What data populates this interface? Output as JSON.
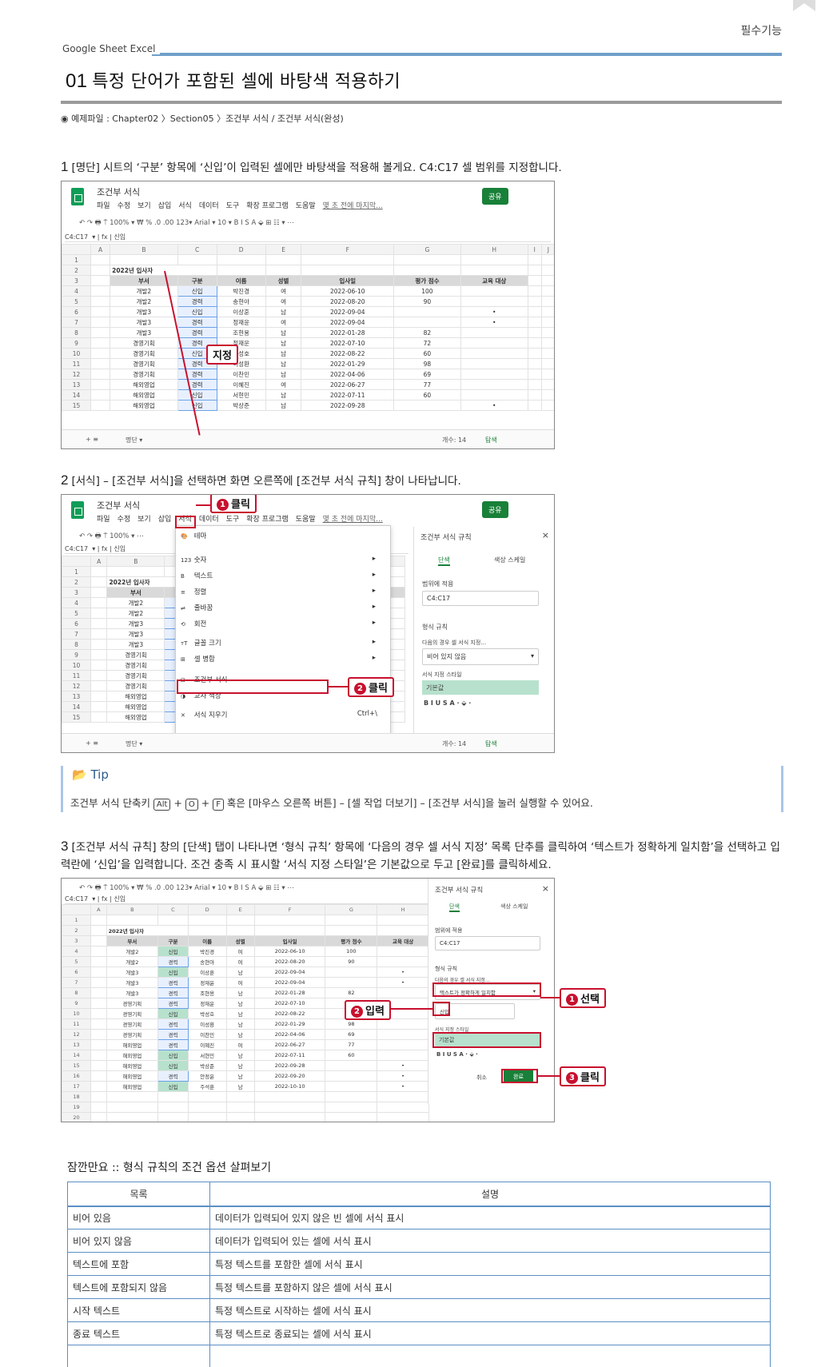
{
  "header": {
    "tag": "필수기능",
    "brand": "Google Sheet  Excel"
  },
  "title": {
    "number": "01",
    "text": "특정 단어가 포함된 셀에 바탕색 적용하기"
  },
  "example_file": "◉ 예제파일 : Chapter02 〉Section05 〉조건부 서식 / 조건부 서식(완성)",
  "steps": [
    {
      "number": "1",
      "text": "[명단] 시트의 ‘구분’ 항목에 ‘신입’이 입력된 셀에만 바탕색을 적용해 볼게요. C4:C17 셀 범위를 지정합니다."
    },
    {
      "number": "2",
      "text": "[서식] – [조건부 서식]을 선택하면 화면 오른쪽에 [조건부 서식 규칙] 창이 나타납니다."
    },
    {
      "number": "3",
      "text": "[조건부 서식 규칙] 창의 [단색] 탭이 나타나면 ‘형식 규칙’ 항목에 ‘다음의 경우 셀 서식 지정’ 목록 단추를 클릭하여 ‘텍스트가 정확하게 일치함’을 선택하고 입력란에 ‘신입’을 입력합니다. 조건 충족 시 표시할 ‘서식 지정 스타일’은 기본값으로 두고 [완료]를 클릭하세요."
    }
  ],
  "sheets": {
    "doc_name": "조건부 서식",
    "menu": [
      "파일",
      "수정",
      "보기",
      "삽입",
      "서식",
      "데이터",
      "도구",
      "확장 프로그램",
      "도움말"
    ],
    "last_edit": "몇 초 전에 마지막...",
    "share": "공유",
    "toolbar": "↶  ↷  🖶  ⍑    100% ▾    ₩   %  .0  .00  123▾    Arial       ▾   10   ▾   B  I  S  A    ⬙  ⊞  ☷ ▾   ⋯",
    "toolbar_short": "↶  ↷  🖶  ⍑    100% ▾    ⋯",
    "name_box": "C4:C17",
    "fx_value": "신입",
    "col_headers": [
      "A",
      "B",
      "C",
      "D",
      "E",
      "F",
      "G",
      "H",
      "I",
      "J"
    ],
    "sheet_title": "2022년 입사자",
    "table_headers": [
      "부서",
      "구분",
      "이름",
      "성별",
      "입사일",
      "평가 점수",
      "교육 대상"
    ],
    "rows": [
      [
        "개발2",
        "신입",
        "박진경",
        "여",
        "2022-06-10",
        "100",
        ""
      ],
      [
        "개발2",
        "경력",
        "송현아",
        "여",
        "2022-08-20",
        "90",
        ""
      ],
      [
        "개발3",
        "신입",
        "이상훈",
        "남",
        "2022-09-04",
        "",
        "•"
      ],
      [
        "개발3",
        "경력",
        "정재윤",
        "여",
        "2022-09-04",
        "",
        "•"
      ],
      [
        "개발3",
        "경력",
        "조현용",
        "남",
        "2022-01-28",
        "82",
        ""
      ],
      [
        "경영기획",
        "경력",
        "정재운",
        "남",
        "2022-07-10",
        "72",
        ""
      ],
      [
        "경영기획",
        "신입",
        "박성호",
        "남",
        "2022-08-22",
        "60",
        ""
      ],
      [
        "경영기획",
        "경력",
        "이성환",
        "남",
        "2022-01-29",
        "98",
        ""
      ],
      [
        "경영기획",
        "경력",
        "이찬민",
        "남",
        "2022-04-06",
        "69",
        ""
      ],
      [
        "해외영업",
        "경력",
        "이혜진",
        "여",
        "2022-06-27",
        "77",
        ""
      ],
      [
        "해외영업",
        "신입",
        "서현민",
        "남",
        "2022-07-11",
        "60",
        ""
      ],
      [
        "해외영업",
        "신입",
        "박상준",
        "남",
        "2022-09-28",
        "",
        "•"
      ],
      [
        "해외영업",
        "경력",
        "안정윤",
        "남",
        "2022-09-20",
        "",
        "•"
      ],
      [
        "해외영업",
        "신입",
        "주석훈",
        "남",
        "2022-10-10",
        "",
        "•"
      ]
    ],
    "sheet_tab": "명단 ▾",
    "count": "개수: 14",
    "explore": "탐색"
  },
  "callouts": {
    "s1_select": "지정",
    "s2_click1": "클릭",
    "s2_click2": "클릭",
    "s3_select": "선택",
    "s3_input": "입력",
    "s3_click": "클릭"
  },
  "format_menu": {
    "items": [
      "테마",
      "숫자",
      "텍스트",
      "정렬",
      "줄바꿈",
      "회전",
      "글꼴 크기",
      "셀 병합",
      "조건부 서식",
      "교차 색상",
      "서식 지우기"
    ],
    "shortcut": "Ctrl+\\"
  },
  "cf_panel": {
    "title": "조건부 서식 규칙",
    "tabs": [
      "단색",
      "색상 스케일"
    ],
    "range_label": "범위에 적용",
    "range_value": "C4:C17",
    "rules_label": "형식 규칙",
    "condition_label": "다음의 경우 셀 서식 지정...",
    "condition_default": "비어 있지 않음",
    "condition_selected": "텍스트가 정확하게 일치함",
    "input_value": "신입",
    "style_label": "서식 지정 스타일",
    "style_value": "기본값",
    "cancel": "취소",
    "done": "완료"
  },
  "tip": {
    "title": "Tip",
    "text_pre": "조건부 서식 단축키 ",
    "keys": [
      "Alt",
      "O",
      "F"
    ],
    "text_post": " 혹은 [마우스 오른쪽 버튼] – [셀 작업 더보기] – [조건부 서식]을 눌러 실행할 수 있어요."
  },
  "options_table": {
    "title": "잠깐만요 :: 형식 규칙의 조건 옵션 살펴보기",
    "headers": [
      "목록",
      "설명"
    ],
    "rows": [
      [
        "비어 있음",
        "데이터가 입력되어 있지 않은 빈 셀에 서식 표시"
      ],
      [
        "비어 있지 않음",
        "데이터가 입력되어 있는 셀에 서식 표시"
      ],
      [
        "텍스트에 포함",
        "특정 텍스트를 포함한 셀에 서식 표시"
      ],
      [
        "텍스트에 포함되지 않음",
        "특정 텍스트를 포함하지 않은 셀에 서식 표시"
      ],
      [
        "시작 텍스트",
        "특정 텍스트로 시작하는 셀에 서식 표시"
      ],
      [
        "종료 텍스트",
        "특정 텍스트로 종료되는 셀에 서식 표시"
      ],
      [
        "",
        ""
      ]
    ]
  },
  "colors": {
    "accent_blue": "#6f9fc9",
    "callout_red": "#c8102e",
    "sheets_green": "#188038",
    "highlight_green": "#b7e1cd"
  }
}
